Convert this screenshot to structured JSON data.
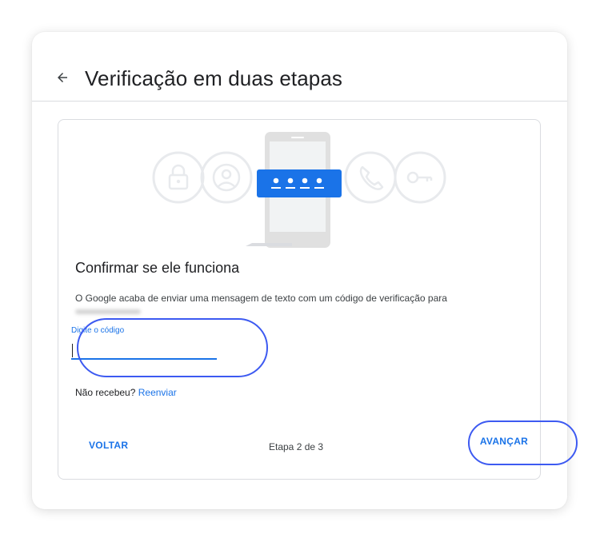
{
  "header": {
    "back_icon": "arrow-back-icon",
    "title": "Verificação em duas etapas"
  },
  "illustration": {
    "icons": [
      "lock-icon",
      "account-icon",
      "phone-icon",
      "key-icon"
    ],
    "code_mask": "• • • •",
    "accent_color": "#1a73e8"
  },
  "content": {
    "heading": "Confirmar se ele funciona",
    "description": "O Google acaba de enviar uma mensagem de texto com um código de verificação para",
    "code_field": {
      "label": "Digite o código",
      "value": ""
    },
    "resend_prefix": "Não recebeu?",
    "resend_link": "Reenviar"
  },
  "footer": {
    "back_label": "VOLTAR",
    "step_text": "Etapa 2 de 3",
    "next_label": "AVANÇAR"
  },
  "colors": {
    "accent": "#1a73e8",
    "highlight_outline": "#3d5af1",
    "text": "#202124",
    "border": "#dadce0"
  }
}
